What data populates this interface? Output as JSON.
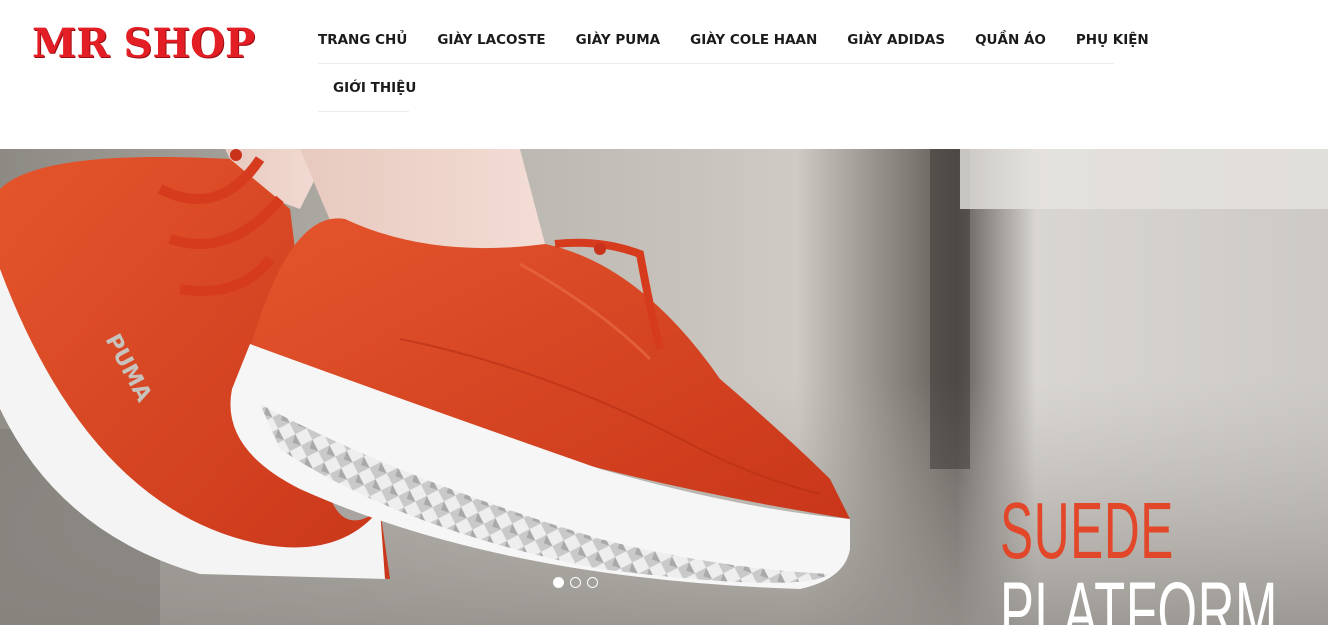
{
  "header": {
    "logo": "MR SHOP",
    "brand_color": "#e31e24"
  },
  "nav": {
    "row1": [
      {
        "label": "TRANG CHỦ"
      },
      {
        "label": "GIÀY LACOSTE"
      },
      {
        "label": "GIÀY PUMA"
      },
      {
        "label": "GIÀY COLE HAAN"
      },
      {
        "label": "GIÀY ADIDAS"
      },
      {
        "label": "QUẦN ÁO"
      },
      {
        "label": "PHỤ KIỆN"
      }
    ],
    "row2": [
      {
        "label": "GIỚI THIỆU"
      }
    ]
  },
  "slider": {
    "slogan_line1": "SUEDE",
    "slogan_line2": "PLATFORM",
    "slogan_accent": "#e2472a",
    "shoe_brand_text": "PUMA",
    "shoe_color": "#d8401f",
    "dots": [
      {
        "state": "active"
      },
      {
        "state": "inactive"
      },
      {
        "state": "inactive"
      }
    ],
    "current_slide": 1,
    "total_slides": 3
  }
}
